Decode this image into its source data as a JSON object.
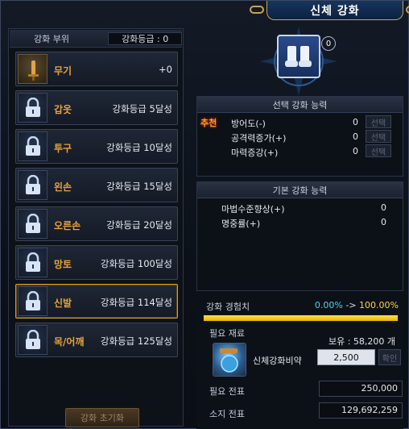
{
  "window": {
    "title": "신체 강화"
  },
  "left": {
    "header_label": "강화 부위",
    "grade_label": "강화등급 : 0",
    "slots": [
      {
        "name": "무기",
        "req": "+0",
        "icon": "sword-icon",
        "locked": false
      },
      {
        "name": "갑옷",
        "req": "강화등급  5달성",
        "icon": "lock-icon",
        "locked": true
      },
      {
        "name": "투구",
        "req": "강화등급  10달성",
        "icon": "lock-icon",
        "locked": true
      },
      {
        "name": "왼손",
        "req": "강화등급  15달성",
        "icon": "lock-icon",
        "locked": true
      },
      {
        "name": "오른손",
        "req": "강화등급  20달성",
        "icon": "lock-icon",
        "locked": true
      },
      {
        "name": "망토",
        "req": "강화등급  100달성",
        "icon": "lock-icon",
        "locked": true
      },
      {
        "name": "신발",
        "req": "강화등급  114달성",
        "icon": "lock-icon",
        "locked": true,
        "selected": true
      },
      {
        "name": "목/어깨",
        "req": "강화등급  125달성",
        "icon": "lock-icon",
        "locked": true
      }
    ],
    "reset_button": "강화 초기화"
  },
  "item": {
    "icon": "boots-icon",
    "count": "0"
  },
  "selected_ability": {
    "title": "선택 강화 능력",
    "badge": "추천",
    "rows": [
      {
        "label": "방어도(-)",
        "value": "0",
        "button": "선택"
      },
      {
        "label": "공격력증가(+)",
        "value": "0",
        "button": "선택"
      },
      {
        "label": "마력증강(+)",
        "value": "0",
        "button": "선택"
      }
    ]
  },
  "basic_ability": {
    "title": "기본 강화 능력",
    "rows": [
      {
        "label": "마법수준향상(+)",
        "value": "0"
      },
      {
        "label": "명중률(+)",
        "value": "0"
      }
    ]
  },
  "exp": {
    "label": "강화 경험치",
    "from": "0.00%",
    "arrow": " -> ",
    "to": "100.00%",
    "fill_percent": 100
  },
  "materials": {
    "label": "필요 재료",
    "owned": "보유 : 58,200 개",
    "item_name": "신체강화비약",
    "item_icon": "potion-icon",
    "quantity": "2,500",
    "confirm": "확인"
  },
  "fees": {
    "required_label": "필요 전표",
    "required_value": "250,000",
    "owned_label": "소지 전표",
    "owned_value": "129,692,259"
  },
  "colors": {
    "accent_orange": "#e8a23a",
    "exp_bar": "#ffd23c",
    "selected_border": "#d79a2a"
  }
}
